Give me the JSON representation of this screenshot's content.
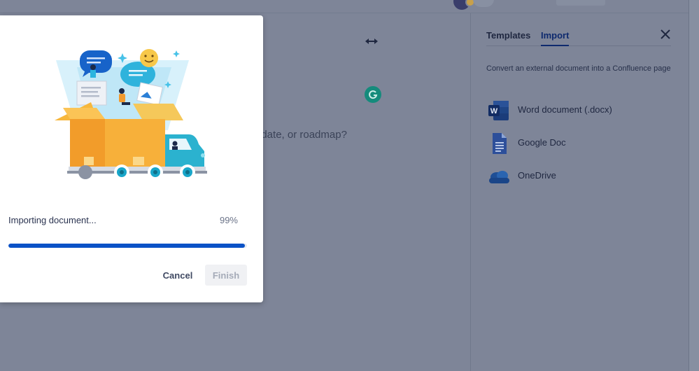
{
  "editor": {
    "placeholder_fragment": "nts, date, or roadmap?"
  },
  "panel": {
    "tabs": [
      {
        "label": "Templates",
        "active": false
      },
      {
        "label": "Import",
        "active": true
      }
    ],
    "description": "Convert an external document into a Confluence page",
    "import_options": [
      {
        "label": "Word document (.docx)",
        "icon": "word-icon"
      },
      {
        "label": "Google Doc",
        "icon": "google-doc-icon"
      },
      {
        "label": "OneDrive",
        "icon": "onedrive-icon"
      }
    ]
  },
  "modal": {
    "status": "Importing document...",
    "percent_label": "99%",
    "progress": 0.99,
    "cancel_label": "Cancel",
    "finish_label": "Finish",
    "illustration": "delivery-truck-box-illustration"
  },
  "colors": {
    "accent": "#0b52c7",
    "overlay": "#7e8598"
  }
}
